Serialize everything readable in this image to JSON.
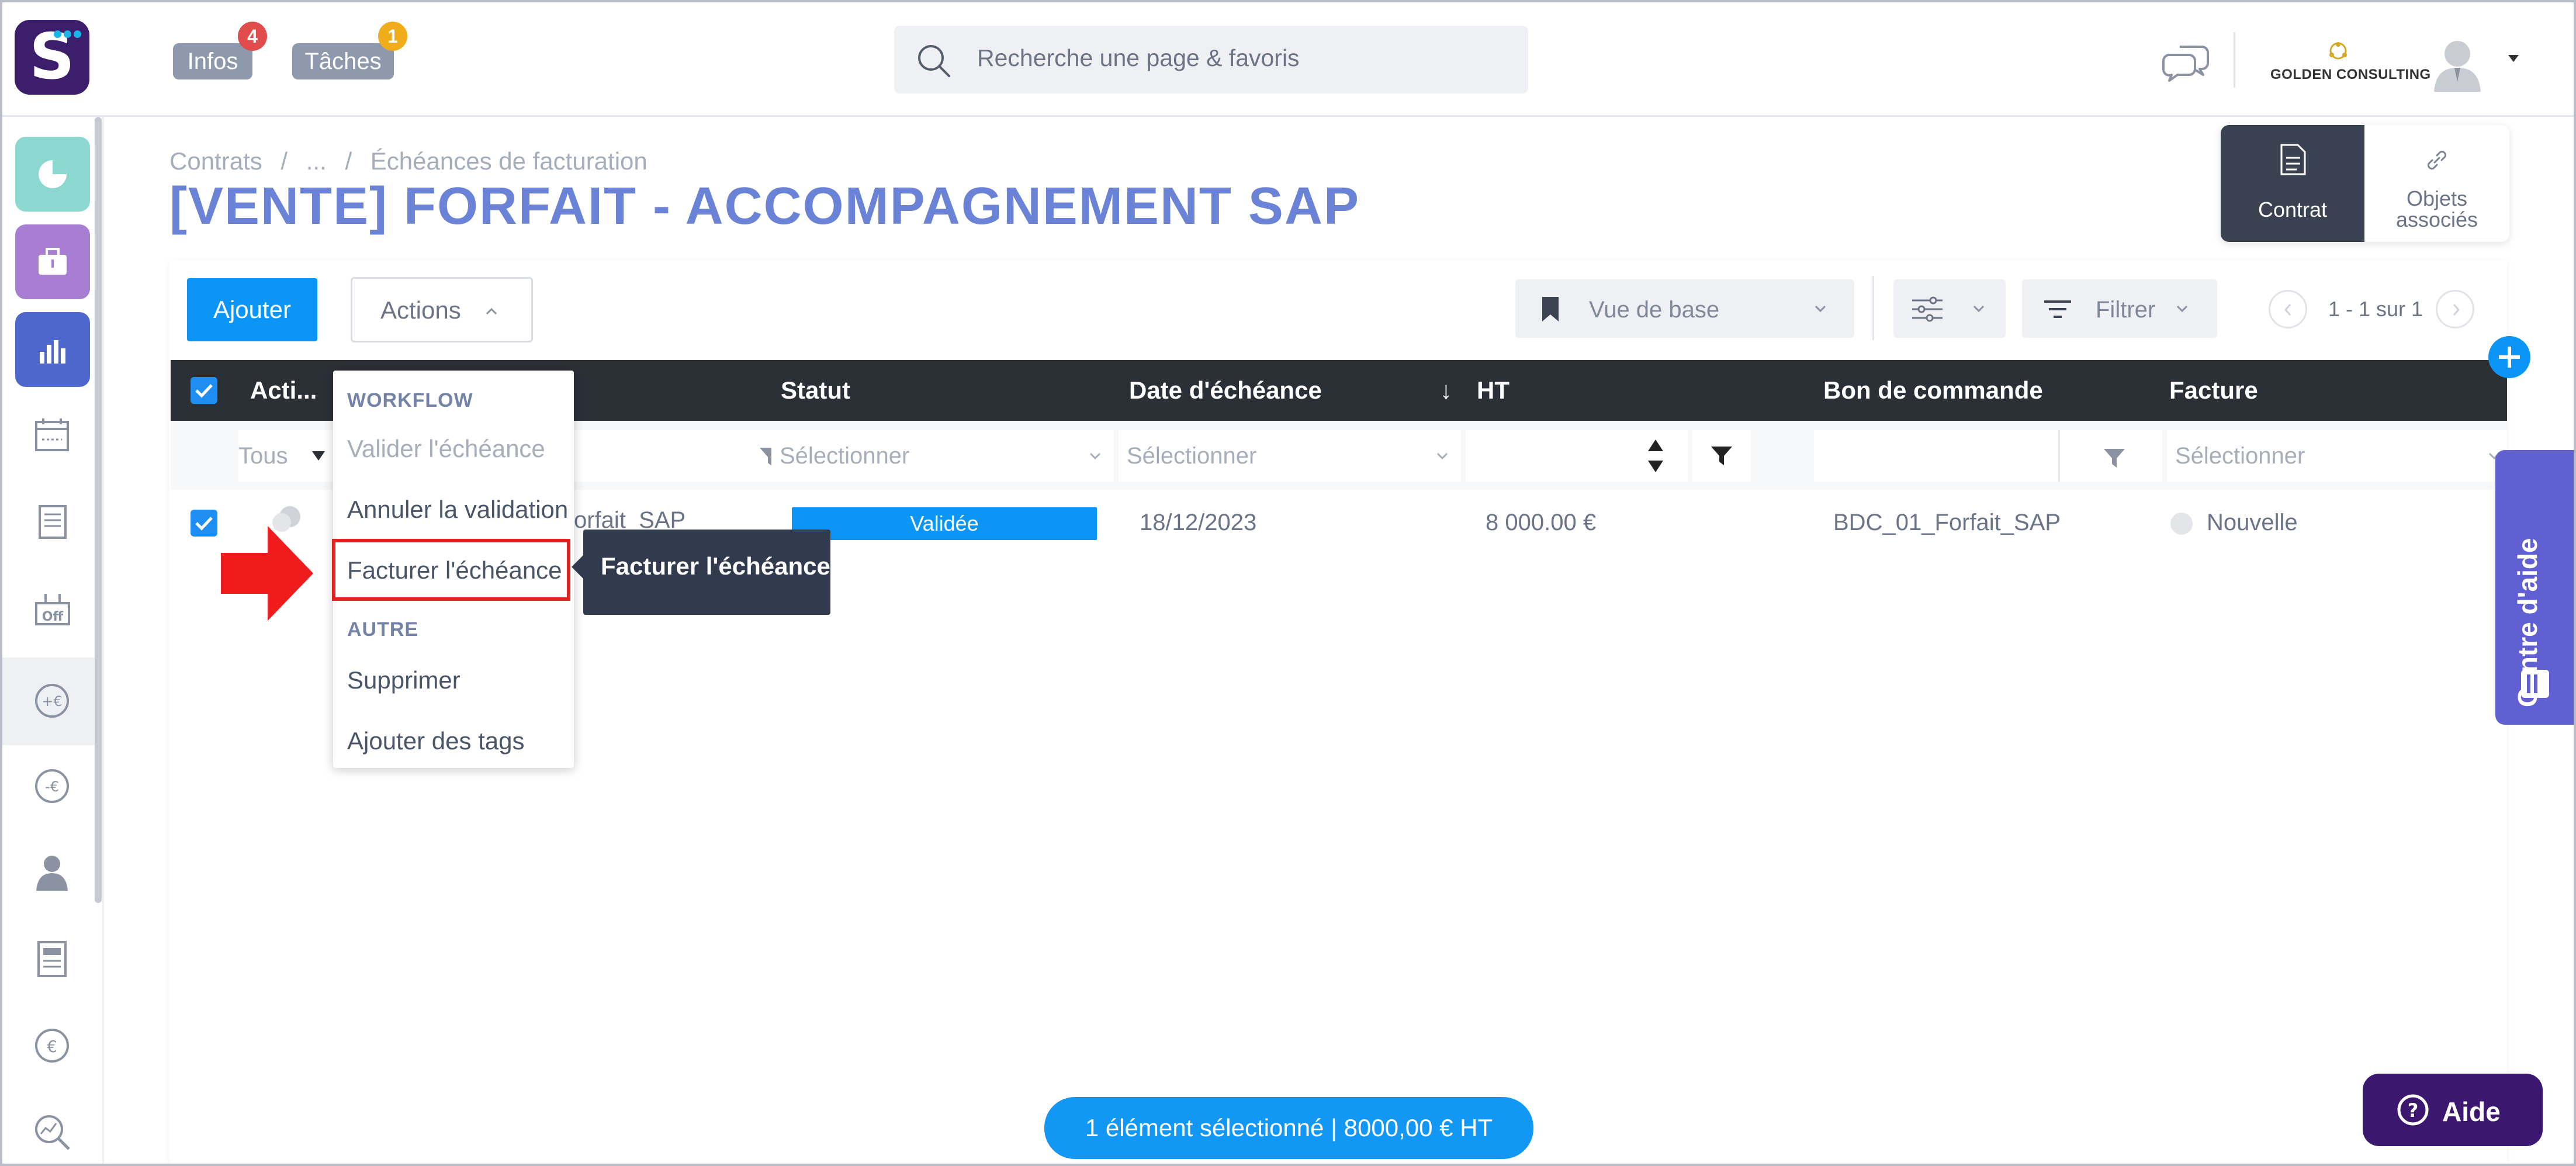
{
  "topbar": {
    "infos_label": "Infos",
    "infos_count": "4",
    "taches_label": "Tâches",
    "taches_count": "1",
    "search_placeholder": "Recherche une page & favoris",
    "company_name": "GOLDEN CONSULTING",
    "icons": [
      "logo-s-icon",
      "search-icon",
      "chat-bubbles-icon",
      "company-logo-icon",
      "user-avatar-icon",
      "caret-down-icon"
    ]
  },
  "sidebar": {
    "icons": [
      "dashboard-pie-icon",
      "briefcase-icon",
      "bar-chart-icon",
      "calendar-icon",
      "invoice-list-icon",
      "off-tag-icon",
      "plus-euro-icon",
      "minus-euro-icon",
      "person-icon",
      "document-icon",
      "euro-circle-icon",
      "search-chart-icon"
    ],
    "active_index": 6
  },
  "header": {
    "breadcrumb": [
      "Contrats",
      "/",
      "...",
      "/",
      "Échéances de facturation"
    ],
    "title": "[VENTE] FORFAIT - ACCOMPAGNEMENT SAP",
    "tabs": [
      {
        "label": "Contrat",
        "icon": "document-icon",
        "active": true
      },
      {
        "label": "Objets associés",
        "icon": "link-icon",
        "active": false
      }
    ]
  },
  "toolbar": {
    "add_label": "Ajouter",
    "actions_label": "Actions",
    "view_label": "Vue de base",
    "filter_label": "Filtrer",
    "pagination": "1 - 1 sur 1"
  },
  "table": {
    "columns": [
      "Acti...",
      "Statut",
      "Date d'échéance",
      "↓",
      "HT",
      "Bon de commande",
      "Facture"
    ],
    "filters": {
      "actions": "Tous",
      "statut": "Sélectionner",
      "date": "Sélectionner",
      "facture": "Sélectionner"
    },
    "rows": [
      {
        "name": "orfait_SAP",
        "statut": "Validée",
        "date": "18/12/2023",
        "ht": "8 000.00 €",
        "bon_commande": "BDC_01_Forfait_SAP",
        "facture": "Nouvelle"
      }
    ]
  },
  "menu": {
    "section1": "WORKFLOW",
    "item1": "Valider l'échéance",
    "item2": "Annuler la validation",
    "item3": "Facturer l'échéance",
    "section2": "AUTRE",
    "item4": "Supprimer",
    "item5": "Ajouter des tags",
    "tooltip": "Facturer l'échéance"
  },
  "help": {
    "side_label": "Centre d'aide",
    "aide_label": "Aide"
  },
  "selection_bar": "1 élément sélectionné   |   8000,00 € HT",
  "colors": {
    "brand": "#3d1e6d",
    "accent": "#0b95f6",
    "title": "#6b83d6",
    "header_dark": "#2b2f36",
    "highlight": "#e1221d"
  }
}
